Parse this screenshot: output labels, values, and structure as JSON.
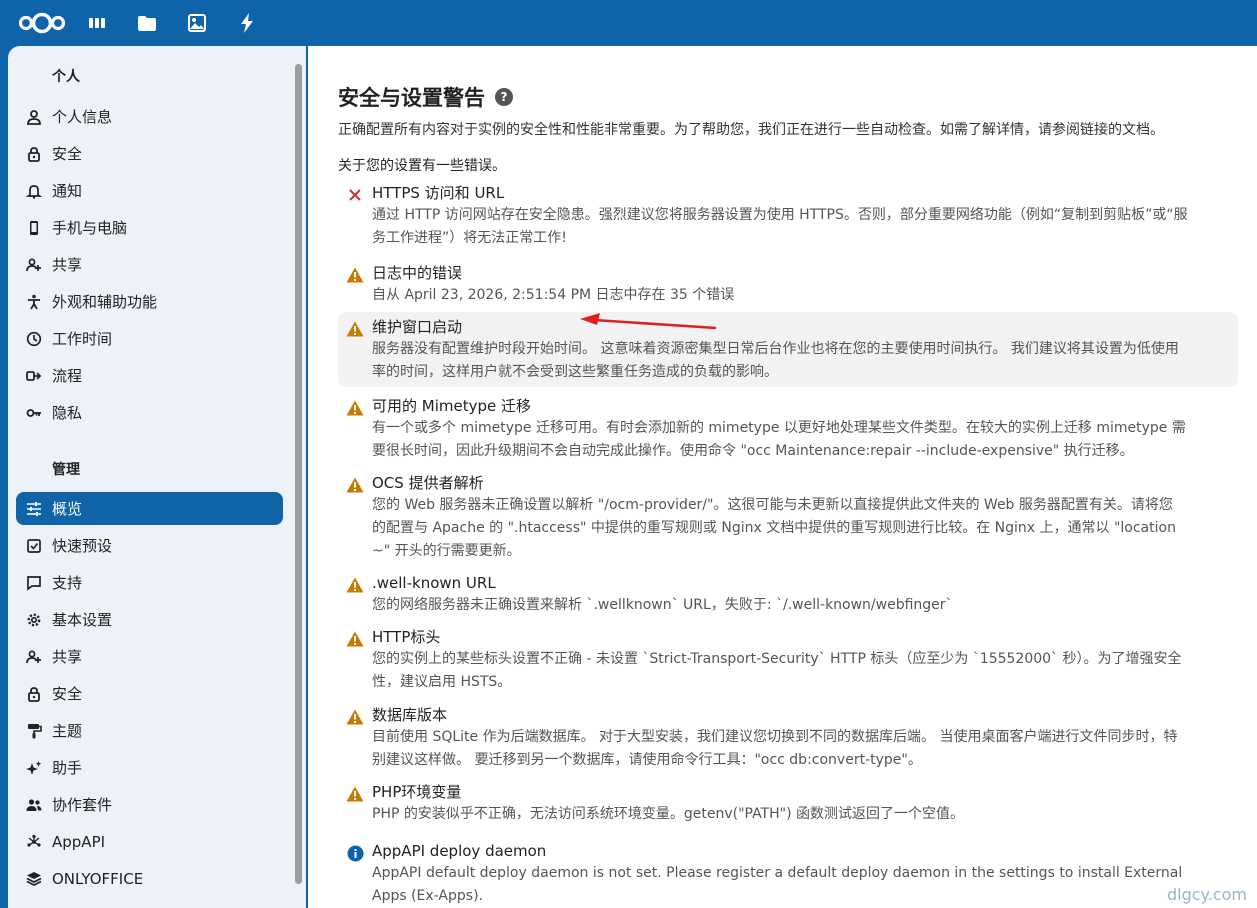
{
  "header": {
    "apps": [
      {
        "name": "dashboard"
      },
      {
        "name": "files"
      },
      {
        "name": "photos"
      },
      {
        "name": "activity"
      }
    ]
  },
  "sidebar": {
    "personal_title": "个人",
    "personal": [
      {
        "label": "个人信息",
        "icon": "user-icon"
      },
      {
        "label": "安全",
        "icon": "lock-icon"
      },
      {
        "label": "通知",
        "icon": "bell-icon"
      },
      {
        "label": "手机与电脑",
        "icon": "phone-icon"
      },
      {
        "label": "共享",
        "icon": "share-icon"
      },
      {
        "label": "外观和辅助功能",
        "icon": "accessibility-icon"
      },
      {
        "label": "工作时间",
        "icon": "clock-icon"
      },
      {
        "label": "流程",
        "icon": "flow-icon"
      },
      {
        "label": "隐私",
        "icon": "key-icon"
      }
    ],
    "admin_title": "管理",
    "admin": [
      {
        "label": "概览",
        "icon": "sliders-icon",
        "active": true
      },
      {
        "label": "快速预设",
        "icon": "checkbox-icon"
      },
      {
        "label": "支持",
        "icon": "chat-icon"
      },
      {
        "label": "基本设置",
        "icon": "gear-icon"
      },
      {
        "label": "共享",
        "icon": "share-icon"
      },
      {
        "label": "安全",
        "icon": "lock-icon"
      },
      {
        "label": "主题",
        "icon": "paint-icon"
      },
      {
        "label": "助手",
        "icon": "sparkle-icon"
      },
      {
        "label": "协作套件",
        "icon": "group-icon"
      },
      {
        "label": "AppAPI",
        "icon": "api-icon"
      },
      {
        "label": "ONLYOFFICE",
        "icon": "layers-icon"
      }
    ]
  },
  "main": {
    "title": "安全与设置警告",
    "help": "?",
    "intro": "正确配置所有内容对于实例的安全性和性能非常重要。为了帮助您，我们正在进行一些自动检查。如需了解详情，请参阅链接的文档。",
    "errors_intro": "关于您的设置有一些错误。",
    "items": [
      {
        "status": "error",
        "title": "HTTPS 访问和 URL",
        "desc": [
          "通过 HTTP 访问网站存在安全隐患。强烈建议您将服务器设置为使用 HTTPS。否则，部分重要网络功能（例如“复制到剪贴板”或“服",
          "务工作进程”）将无法正常工作!"
        ]
      },
      {
        "status": "warning",
        "title": "日志中的错误",
        "desc": [
          "自从 April 23, 2026, 2:51:54 PM 日志中存在 35 个错误"
        ]
      },
      {
        "status": "warning",
        "title": "维护窗口启动",
        "highlight": true,
        "desc": [
          "服务器没有配置维护时段开始时间。 这意味着资源密集型日常后台作业也将在您的主要使用时间执行。 我们建议将其设置为低使用",
          "率的时间，这样用户就不会受到这些繁重任务造成的负载的影响。"
        ]
      },
      {
        "status": "warning",
        "title": "可用的 Mimetype 迁移",
        "desc": [
          "有一个或多个 mimetype 迁移可用。有时会添加新的 mimetype 以更好地处理某些文件类型。在较大的实例上迁移 mimetype 需",
          "要很长时间，因此升级期间不会自动完成此操作。使用命令 \"occ Maintenance:repair --include-expensive\" 执行迁移。"
        ]
      },
      {
        "status": "warning",
        "title": "OCS 提供者解析",
        "desc": [
          "您的 Web 服务器未正确设置以解析 \"/ocm-provider/\"。这很可能与未更新以直接提供此文件夹的 Web 服务器配置有关。请将您",
          "的配置与 Apache 的 \".htaccess\" 中提供的重写规则或 Nginx 文档中提供的重写规则进行比较。在 Nginx 上，通常以 \"location",
          "~\" 开头的行需要更新。"
        ]
      },
      {
        "status": "warning",
        "title": ".well-known URL",
        "desc": [
          "您的网络服务器未正确设置来解析 `.wellknown` URL，失败于: `/.well-known/webfinger`"
        ]
      },
      {
        "status": "warning",
        "title": "HTTP标头",
        "desc": [
          "您的实例上的某些标头设置不正确 - 未设置 `Strict-Transport-Security` HTTP 标头（应至少为 `15552000` 秒）。为了增强安全",
          "性，建议启用 HSTS。"
        ]
      },
      {
        "status": "warning",
        "title": "数据库版本",
        "desc": [
          "目前使用 SQLite 作为后端数据库。 对于大型安装，我们建议您切换到不同的数据库后端。 当使用桌面客户端进行文件同步时，特",
          "别建议这样做。 要迁移到另一个数据库，请使用命令行工具：\"occ db:convert-type\"。"
        ]
      },
      {
        "status": "warning",
        "title": "PHP环境变量",
        "desc": [
          "PHP 的安装似乎不正确，无法访问系统环境变量。getenv(\"PATH\") 函数测试返回了一个空值。"
        ]
      },
      {
        "status": "info",
        "title": "AppAPI deploy daemon",
        "desc": [
          "AppAPI default deploy daemon is not set. Please register a default deploy daemon in the settings to install External",
          "Apps (Ex-Apps)."
        ]
      }
    ]
  },
  "watermark": "dlgcy.com",
  "colors": {
    "brand": "#0f63a8",
    "warning": "#c97a00",
    "error": "#d32f2f",
    "info": "#0f63a8"
  }
}
